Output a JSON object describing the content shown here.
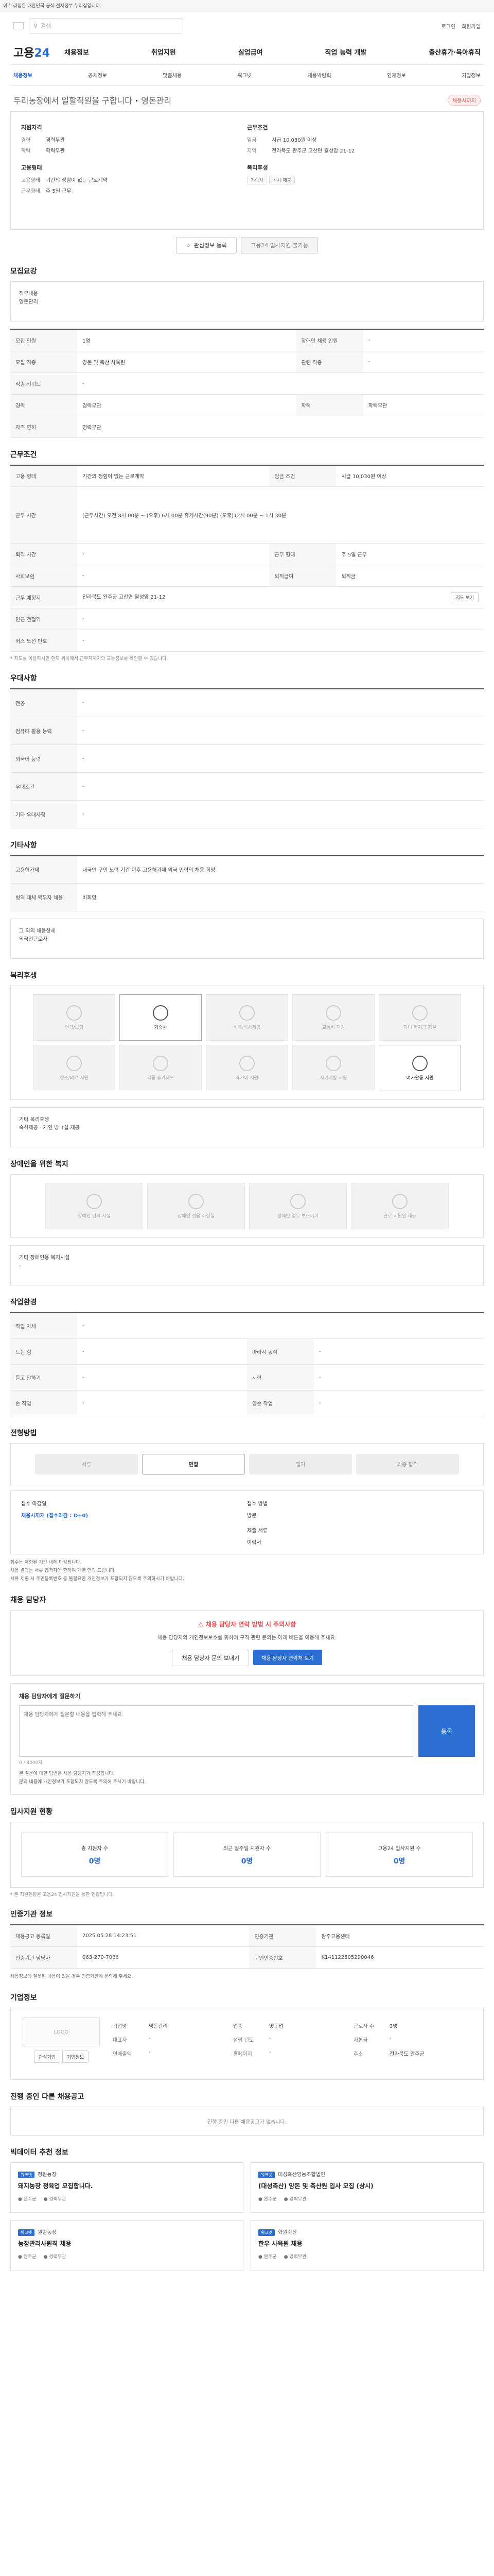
{
  "gov_banner": "이 누리집은 대한민국 공식 전자정부 누리집입니다.",
  "topbar": {
    "search_placeholder": "검색",
    "links": [
      "로그인",
      "회원가입"
    ]
  },
  "gnb": {
    "logo_a": "고용",
    "logo_b": "24",
    "menu": [
      "채용정보",
      "취업지원",
      "실업급여",
      "직업 능력 개발",
      "출산휴가·육아휴직"
    ]
  },
  "lnb": [
    "채용정보",
    "공채정보",
    "맞춤채용",
    "워크넷",
    "채용박람회",
    "인재정보",
    "기업정보"
  ],
  "job": {
    "title": "두리농장에서 일할직원을 구합니다",
    "company": "영돈관리",
    "badge": "채용시까지"
  },
  "summary": {
    "left_h": "지원자격",
    "left": [
      {
        "k": "경력",
        "v": "경력무관"
      },
      {
        "k": "학력",
        "v": "학력무관"
      }
    ],
    "left_h2": "고용형태",
    "left2": [
      {
        "k": "고용형태",
        "v": "기간의 정함이 없는 근로계약"
      },
      {
        "k": "근무형태",
        "v": "주 5일 근무"
      }
    ],
    "right_h": "근무조건",
    "right": [
      {
        "k": "임금",
        "v": "시급 10,030원 이상"
      },
      {
        "k": "지역",
        "v": "전라북도 완주군 고산면 월성암 21-12"
      }
    ],
    "right_h2": "복리후생",
    "chips": [
      "기숙사",
      "식사 제공"
    ]
  },
  "buttons": {
    "interest": "관심정보 등록",
    "apply": "고용24 입사지원 불가능"
  },
  "sec_desc": {
    "title": "모집요강",
    "h1": "직무내용",
    "v1": "양돈관리"
  },
  "recruit": {
    "rows": [
      {
        "k": "모집 인원",
        "v": "1명",
        "k2": "장애인 채용 인원",
        "v2": "-"
      },
      {
        "k": "모집 직종",
        "v": "양돈 및 축산 사육원",
        "k2": "관련 직종",
        "v2": "-"
      },
      {
        "k": "직종 키워드",
        "v": "-",
        "k2": "",
        "v2": ""
      },
      {
        "k": "경력",
        "v": "경력무관",
        "k2": "학력",
        "v2": "학력무관"
      },
      {
        "k": "자격 면허",
        "v": "경력무관",
        "k2": "",
        "v2": ""
      }
    ]
  },
  "cond": {
    "title": "근무조건",
    "rows": [
      {
        "k": "고용 형태",
        "v": "기간의 정함이 없는 근로계약",
        "k2": "임금 조건",
        "v2": "시급 10,030원 이상"
      },
      {
        "k": "근무 시간",
        "v": "(근무시간)  오전 8시 00분 ~ (오후) 6시 00분  휴게시간(90분) (오후)12시 00분 ~ 1시 30분",
        "k2": "",
        "v2": ""
      },
      {
        "k": "퇴직 시간",
        "v": "-",
        "k2": "근무 형태",
        "v2": "주 5일 근무"
      },
      {
        "k": "사회보험",
        "v": "-",
        "k2": "퇴직급여",
        "v2": "퇴직금"
      },
      {
        "k": "근무 예정지",
        "v": "전라북도 완주군 고산면 월성암 21-12",
        "k2": "",
        "v2": ""
      },
      {
        "k": "인근 전철역",
        "v": "-",
        "k2": "",
        "v2": ""
      },
      {
        "k": "버스 노선 번호",
        "v": "-",
        "k2": "",
        "v2": ""
      }
    ],
    "note": "* 지도를 이용하시면 현재 위치에서 근무지까지의 교통정보를 확인할 수 있습니다.",
    "map_btn": "지도 보기"
  },
  "pref": {
    "title": "우대사항",
    "rows": [
      {
        "k": "전공",
        "v": "-"
      },
      {
        "k": "컴퓨터 활용 능력",
        "v": "-"
      },
      {
        "k": "외국어 능력",
        "v": "-"
      },
      {
        "k": "우대조건",
        "v": "-"
      },
      {
        "k": "기타 우대사항",
        "v": "-"
      }
    ]
  },
  "etc": {
    "title": "기타사항",
    "rows": [
      {
        "k": "고용허가제",
        "v": "내국인 구인 노력 기간 이후 고용허가제 외국 인력의 채용 희망"
      },
      {
        "k": "병역 대체 복무자 채용",
        "v": "비희망"
      }
    ],
    "box_h": "그 외의 채용상세",
    "box_v": "외국인근로자"
  },
  "welfare": {
    "title": "복리후생",
    "items": [
      "연금/보험",
      "기숙사",
      "식대/식사제공",
      "교통비 지원",
      "자녀 학자금 지원",
      "경조/의료 지원",
      "각종 휴가제도",
      "휴가비 지원",
      "자기계발 지원",
      "여가활동 지원"
    ],
    "on": [
      1,
      9
    ],
    "box_h": "기타 복리후생",
    "box_v": "숙식제공 - 개인 방 1실 제공"
  },
  "disab": {
    "title": "장애인을 위한 복지",
    "items": [
      "장애인 편의 시설",
      "장애인 전용 화장실",
      "장애인 업무 보조기기",
      "근로 지원인 제공"
    ],
    "box_h": "기타 장애인용 복지시설",
    "box_v": "-"
  },
  "env": {
    "title": "작업환경",
    "rows": [
      {
        "k": "작업 자세",
        "v": "-",
        "k2": "",
        "v2": ""
      },
      {
        "k": "드는 힘",
        "v": "-",
        "k2": "바라시 동작",
        "v2": "-"
      },
      {
        "k": "듣고 말하기",
        "v": "-",
        "k2": "시력",
        "v2": "-"
      },
      {
        "k": "손 작업",
        "v": "-",
        "k2": "양손 작업",
        "v2": "-"
      }
    ]
  },
  "process": {
    "title": "전형방법",
    "steps": [
      "서류",
      "면접",
      "필기",
      "최종 합격"
    ],
    "on": 1,
    "c1_h": "접수 마감일",
    "c1_v": "채용시까지 (접수마감 : D+0)",
    "c2_h": "접수 방법",
    "c2_v": "방문",
    "c3_h": "제출 서류",
    "c3_v": "이력서",
    "bul": [
      "접수는 제한된 기간 내에 마감됩니다.",
      "채용 결과는 서류 합격자에 한하여 개별 연락 드립니다.",
      "서류 제출 시 주민등록번호 등 불필요한 개인정보가 포함되지 않도록 주의하시기 바랍니다."
    ]
  },
  "contact": {
    "title": "채용 담당자",
    "notice_h": "채용 담당자 연락 방법 시 주의사항",
    "notice_p": "채용 담당자의 개인정보보호를 위하여 구직 관련 문의는 아래 버튼을 이용해 주세요.",
    "b1": "채용 담당자 문의 보내기",
    "b2": "채용 담당자 연락처 보기"
  },
  "qna": {
    "title": "채용 담당자에게 질문하기",
    "placeholder": "채용 담당자에게 질문할 내용을 입력해 주세요.",
    "btn": "등록",
    "count": "0 / 4000자",
    "bul": [
      "본 질문에 대한 답변은 채용 담당자가 작성합니다.",
      "문의 내용에 개인정보가 포함되지 않도록 주의해 주시기 바랍니다."
    ]
  },
  "stat": {
    "title": "입사지원 현황",
    "items": [
      {
        "l": "총 지원자 수",
        "n": "0명"
      },
      {
        "l": "최근 일주일 지원자 수",
        "n": "0명"
      },
      {
        "l": "고용24 입사지원 수",
        "n": "0명"
      }
    ],
    "note": "* 본 지원현황은 고용24 입사지원을 통한 현황입니다."
  },
  "info": {
    "title": "인증기관 정보",
    "rows": [
      {
        "k": "채용공고 등록일",
        "v": "2025.05.28 14:23:51",
        "k2": "인증기관",
        "v2": "완주고용센터"
      },
      {
        "k": "인증기관 담당자",
        "v": "063-270-7066",
        "k2": "구인인증번호",
        "v2": "K141122505290046"
      }
    ],
    "bul": [
      "채용정보에 잘못된 내용이 있을 경우 인증기관에 문의해 주세요."
    ]
  },
  "corp": {
    "title": "기업정보",
    "logo": "LOGO",
    "b1": "관심기업",
    "b2": "기업정보",
    "rows": [
      {
        "k": "기업명",
        "v": "영돈관리"
      },
      {
        "k": "업종",
        "v": "양돈업"
      },
      {
        "k": "근로자 수",
        "v": "3명"
      },
      {
        "k": "대표자",
        "v": "-"
      },
      {
        "k": "설립 년도",
        "v": "-"
      },
      {
        "k": "자본금",
        "v": "-"
      },
      {
        "k": "연매출액",
        "v": "-"
      },
      {
        "k": "홈페이지",
        "v": "-"
      },
      {
        "k": "주소",
        "v": "전라북도 완주군"
      }
    ]
  },
  "same": {
    "title": "진행 중인 다른 채용공고",
    "empty": "진행 중인 다른 채용공고가 없습니다."
  },
  "rec": {
    "title": "빅데이터 추천 정보",
    "items": [
      {
        "tag": "워크넷",
        "corp": "정원농장",
        "title": "돼지농장 정육업 모집합니다.",
        "m1": "완주군",
        "m2": "경력무관"
      },
      {
        "tag": "워크넷",
        "corp": "대성축산영농조합법인",
        "title": "(대성축산) 양돈 및 축산원 입사 모집 (상시)",
        "m1": "완주군",
        "m2": "경력무관"
      },
      {
        "tag": "워크넷",
        "corp": "원림농장",
        "title": "농장관리사원직 채용",
        "m1": "완주군",
        "m2": "경력무관"
      },
      {
        "tag": "워크넷",
        "corp": "화원축산",
        "title": "한우 사육원 채용",
        "m1": "완주군",
        "m2": "경력무관"
      }
    ]
  }
}
